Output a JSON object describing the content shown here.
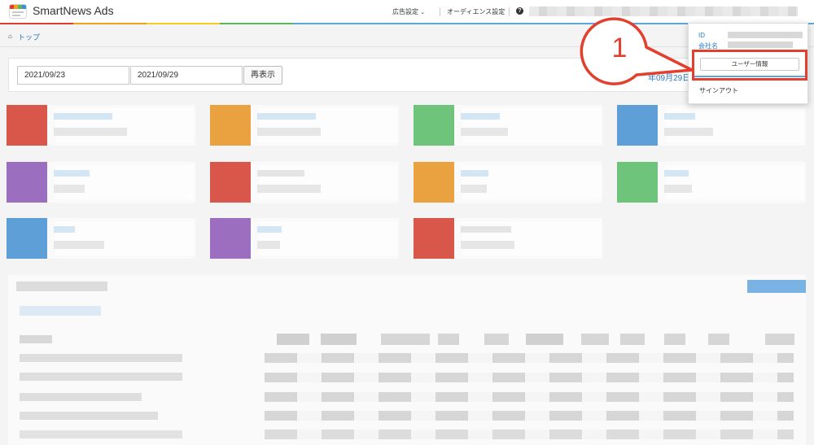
{
  "app": {
    "brand": "SmartNews Ads"
  },
  "header": {
    "nav_ad_settings": "広告設定",
    "nav_ad_settings_caret": "⌄",
    "nav_audience": "オーディエンス設定",
    "help_icon": "?"
  },
  "breadcrumb": {
    "home_icon": "home-icon",
    "top": "トップ"
  },
  "date_filter": {
    "start": "2021/09/23",
    "end": "2021/09/29",
    "refresh_label": "再表示",
    "range_partial": "年09月29日"
  },
  "user_menu": {
    "id_label": "ID",
    "company_label": "会社名",
    "user_info_button": "ユーザー情報",
    "sign_out": "サインアウト"
  },
  "annotation": {
    "step_number": "1",
    "color": "#e2402d"
  },
  "colors": {
    "accent": "#2a7ac9",
    "card_red": "#d9564a",
    "card_orange": "#e9a23f",
    "card_green": "#6fc47b",
    "card_blue": "#5d9fd6",
    "card_purple": "#9c6ec0"
  }
}
